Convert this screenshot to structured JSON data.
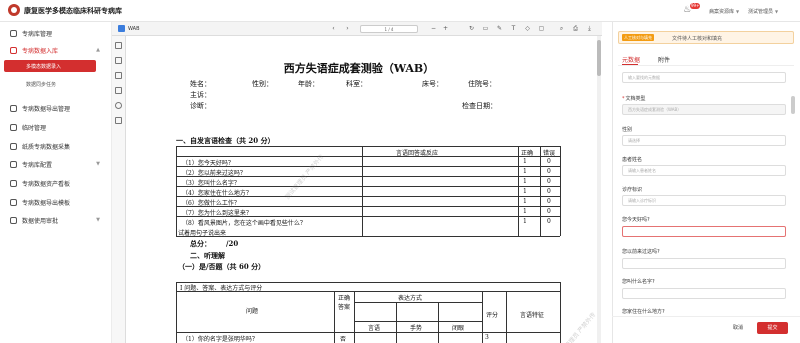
{
  "header": {
    "app_title": "康复医学多模态临床科研专病库",
    "notification_count": "99+",
    "user_dept": "病案资源库",
    "user_name": "测试管理员"
  },
  "sidebar": {
    "items": [
      {
        "label": "专病库管理"
      },
      {
        "label": "专病数据入库"
      },
      {
        "label": "多模态数据录入"
      },
      {
        "label": "数据同步任务"
      },
      {
        "label": "专病数据导出管理"
      },
      {
        "label": "临时管理"
      },
      {
        "label": "纸质专病数据采集"
      },
      {
        "label": "专病库配置"
      },
      {
        "label": "专病数据资产看板"
      },
      {
        "label": "专病数据导出模板"
      },
      {
        "label": "数据使用审批"
      }
    ]
  },
  "pdf": {
    "file_name": "WAB",
    "pager": "1 / 4",
    "title": "西方失语症成套测验（WAB）",
    "fields": {
      "name": "姓名：",
      "sex": "性别：",
      "age": "年龄：",
      "dept": "科室：",
      "bed": "床号：",
      "admission": "住院号：",
      "complaint": "主诉：",
      "diagnosis": "诊断：",
      "exam_date": "检查日期："
    },
    "section1": "一、自发言语检查（共 20 分）",
    "table1": {
      "headers": {
        "response": "言语回答或反应",
        "correct": "正确",
        "wrong": "错误"
      },
      "rows": [
        {
          "q": "（1）您今天好吗？",
          "c": "1",
          "w": "0"
        },
        {
          "q": "（2）您以前来过这吗？",
          "c": "1",
          "w": "0"
        },
        {
          "q": "（3）您叫什么名字？",
          "c": "1",
          "w": "0"
        },
        {
          "q": "（4）您家住在什么地方？",
          "c": "1",
          "w": "0"
        },
        {
          "q": "（6）您做什么工作？",
          "c": "1",
          "w": "0"
        },
        {
          "q": "（7）您为什么到这里来？",
          "c": "1",
          "w": "0"
        },
        {
          "q": "（8）看风景图片，您在这个画中看见些什么？",
          "q2": "试着用句子说出来",
          "c": "1",
          "w": "0"
        }
      ]
    },
    "total": "总分：",
    "total_value": "/20",
    "section2": "二、听理解",
    "subsection": "（一）是/否题（共 60 分）",
    "table2": {
      "caption": "Ⅰ  问题、答案、表达方式与评分",
      "question": "问题",
      "correct_answer": "正确答案",
      "expression": "表达方式",
      "speech": "言语",
      "gesture": "手势",
      "eyes_closed": "闭眼",
      "score": "评分",
      "features": "言语特征",
      "row1": "（1）你的名字是张明华吗？",
      "row1_answer": "否",
      "row1_score": "3"
    },
    "watermark": "测试管理员 严禁外传"
  },
  "panel": {
    "alert_badge": "人工核对与填充",
    "alert_text": "文件待人工核对和填充",
    "tab_meta": "元数据",
    "tab_attach": "附件",
    "meta_placeholder": "输入要找的元数据",
    "doc_type_label": "文档类型",
    "doc_type_value": "西方失语症成套测验（WAB）",
    "sex_label": "性别",
    "sex_placeholder": "请选择",
    "patient_name_label": "患者姓名",
    "patient_name_placeholder": "请输入患者姓名",
    "id_label": "诊疗标识",
    "id_placeholder": "请输入诊疗标识",
    "q1_label": "您今天好吗?",
    "q2_label": "您以前来过这吗?",
    "q3_label": "您叫什么名字?",
    "q4_label": "您家住在什么地方?",
    "cancel": "取消",
    "submit": "提交"
  }
}
